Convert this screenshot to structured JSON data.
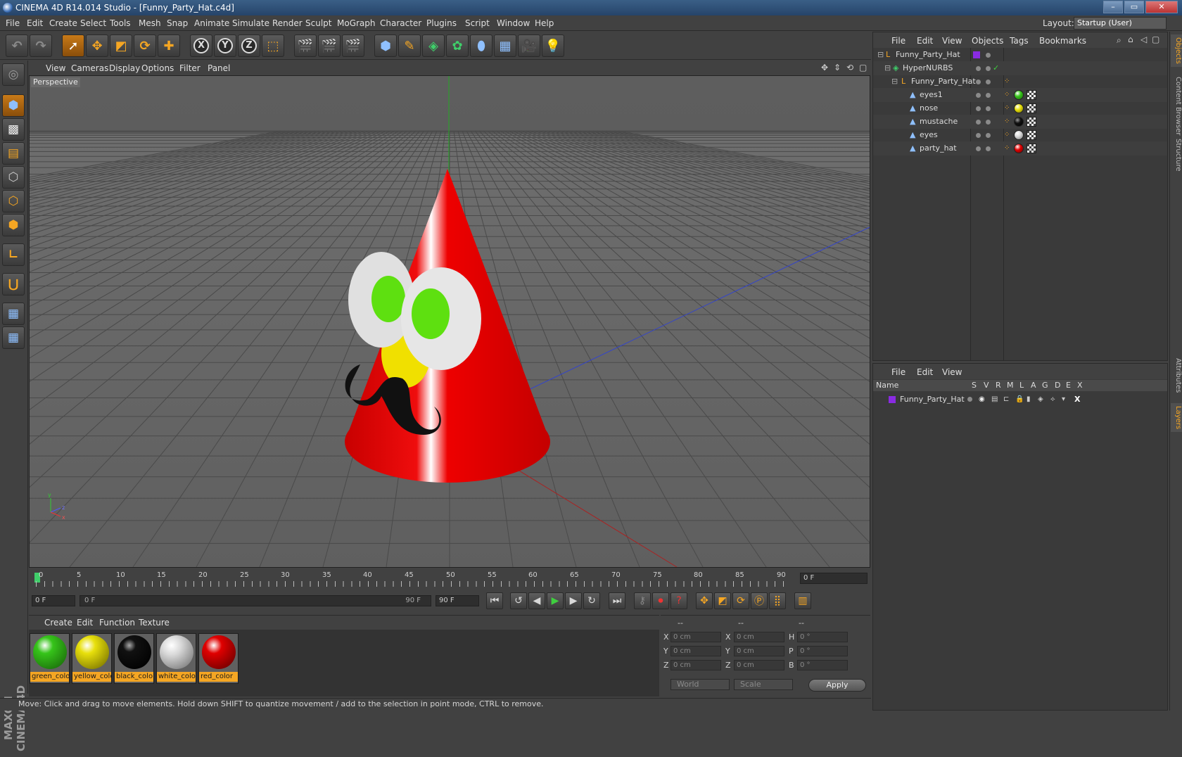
{
  "window": {
    "title": "CINEMA 4D R14.014 Studio - [Funny_Party_Hat.c4d]"
  },
  "menubar": {
    "items": [
      "File",
      "Edit",
      "Create",
      "Select",
      "Tools",
      "Mesh",
      "Snap",
      "Animate",
      "Simulate",
      "Render",
      "Sculpt",
      "MoGraph",
      "Character",
      "Plugins",
      "Script",
      "Window",
      "Help"
    ],
    "layout_label": "Layout:",
    "layout_value": "Startup (User)"
  },
  "viewport": {
    "menu": [
      "View",
      "Cameras",
      "Display",
      "Options",
      "Filter",
      "Panel"
    ],
    "label": "Perspective"
  },
  "timeline": {
    "ticks": [
      "0",
      "5",
      "10",
      "15",
      "20",
      "25",
      "30",
      "35",
      "40",
      "45",
      "50",
      "55",
      "60",
      "65",
      "70",
      "75",
      "80",
      "85",
      "90"
    ],
    "current_frame_right": "0 F",
    "start_field": "0 F",
    "range_start": "0 F",
    "range_end": "90 F",
    "end_field": "90 F"
  },
  "materials": {
    "menu": [
      "Create",
      "Edit",
      "Function",
      "Texture"
    ],
    "items": [
      {
        "name": "green_colo",
        "color": "#36c41a"
      },
      {
        "name": "yellow_colo",
        "color": "#e8e00c"
      },
      {
        "name": "black_colo",
        "color": "#0a0a0a"
      },
      {
        "name": "white_colo",
        "color": "#d8d8d8"
      },
      {
        "name": "red_color",
        "color": "#e00000"
      }
    ]
  },
  "coords": {
    "headers": [
      "--",
      "--",
      "--"
    ],
    "rows": [
      {
        "a": "X",
        "av": "0 cm",
        "b": "X",
        "bv": "0 cm",
        "c": "H",
        "cv": "0 °"
      },
      {
        "a": "Y",
        "av": "0 cm",
        "b": "Y",
        "bv": "0 cm",
        "c": "P",
        "cv": "0 °"
      },
      {
        "a": "Z",
        "av": "0 cm",
        "b": "Z",
        "bv": "0 cm",
        "c": "B",
        "cv": "0 °"
      }
    ],
    "mode1": "World",
    "mode2": "Scale",
    "apply": "Apply"
  },
  "status": "Move: Click and drag to move elements. Hold down SHIFT to quantize movement / add to the selection in point mode, CTRL to remove.",
  "objects": {
    "menu": [
      "File",
      "Edit",
      "View",
      "Objects",
      "Tags",
      "Bookmarks"
    ],
    "rows": [
      {
        "name": "Funny_Party_Hat",
        "indent": 0
      },
      {
        "name": "HyperNURBS",
        "indent": 1
      },
      {
        "name": "Funny_Party_Hat",
        "indent": 2
      },
      {
        "name": "eyes1",
        "indent": 3,
        "tag": "#36c41a"
      },
      {
        "name": "nose",
        "indent": 3,
        "tag": "#e8e00c"
      },
      {
        "name": "mustache",
        "indent": 3,
        "tag": "#0a0a0a"
      },
      {
        "name": "eyes",
        "indent": 3,
        "tag": "#d8d8d8"
      },
      {
        "name": "party_hat",
        "indent": 3,
        "tag": "#e00000"
      }
    ]
  },
  "layers": {
    "menu": [
      "File",
      "Edit",
      "View"
    ],
    "columns": [
      "Name",
      "S",
      "V",
      "R",
      "M",
      "L",
      "A",
      "G",
      "D",
      "E",
      "X"
    ],
    "rows": [
      {
        "name": "Funny_Party_Hat"
      }
    ]
  },
  "sidetabs": [
    "Objects",
    "Content Browser",
    "Structure",
    "Attributes",
    "Layers"
  ],
  "logo": "MAXON CINEMA 4D"
}
